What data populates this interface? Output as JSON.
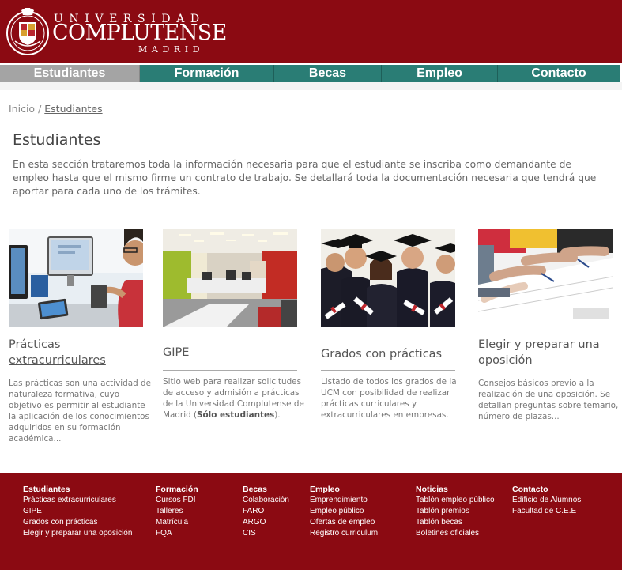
{
  "header": {
    "logo_line1": "UNIVERSIDAD",
    "logo_line2": "COMPLUTENSE",
    "logo_line3": "MADRID",
    "brand_color": "#8b0a12"
  },
  "nav": {
    "items": [
      {
        "label": "Estudiantes",
        "active": true
      },
      {
        "label": "Formación"
      },
      {
        "label": "Becas"
      },
      {
        "label": "Empleo"
      },
      {
        "label": "Contacto"
      }
    ],
    "accent_color": "#2a7d75"
  },
  "breadcrumb": {
    "home": "Inicio",
    "separator": "/",
    "current": "Estudiantes"
  },
  "main": {
    "title": "Estudiantes",
    "intro": "En esta sección trataremos toda la información necesaria para que el estudiante se inscriba como demandante de empleo hasta que el mismo firme un contrato de trabajo. Se detallará toda la documentación necesaria que tendrá que aportar para cada uno de los trámites."
  },
  "cards": [
    {
      "title": "Prácticas extracurriculares",
      "description": "Las prácticas son una actividad de naturaleza formativa, cuyo objetivo es permitir al estudiante la aplicación de los conocimientos adquiridos en su formación académica..."
    },
    {
      "title": "GIPE",
      "description": "Sitio web para realizar solicitudes de acceso y admisión a prácticas de la Universidad Complutense de Madrid (",
      "description_bold": "Sólo estudiantes",
      "description_end": ")."
    },
    {
      "title": "Grados con prácticas",
      "description": "Listado de todos los grados de la UCM con posibilidad de realizar prácticas curriculares y extracurriculares en empresas."
    },
    {
      "title": "Elegir y preparar una oposición",
      "description": "Consejos básicos previo a la realización de una oposición. Se detallan preguntas sobre temario, número de plazas..."
    }
  ],
  "footer": {
    "columns": [
      {
        "heading": "Estudiantes",
        "links": [
          "Prácticas extracurriculares",
          "GIPE",
          "Grados con prácticas",
          "Elegir y preparar una oposición"
        ]
      },
      {
        "heading": "Formación",
        "links": [
          "Cursos FDI",
          "Talleres",
          "Matrícula",
          "FQA"
        ]
      },
      {
        "heading": "Becas",
        "links": [
          "Colaboración",
          "FARO",
          "ARGO",
          "CIS"
        ]
      },
      {
        "heading": "Empleo",
        "links": [
          "Emprendimiento",
          "Empleo público",
          "Ofertas de empleo",
          "Registro curriculum"
        ]
      },
      {
        "heading": "Noticias",
        "links": [
          "Tablón empleo público",
          "Tablón premios",
          "Tablón becas",
          "Boletines oficiales"
        ]
      },
      {
        "heading": "Contacto",
        "links": [
          "Edificio de Alumnos",
          "Facultad de C.E.E"
        ]
      }
    ]
  }
}
